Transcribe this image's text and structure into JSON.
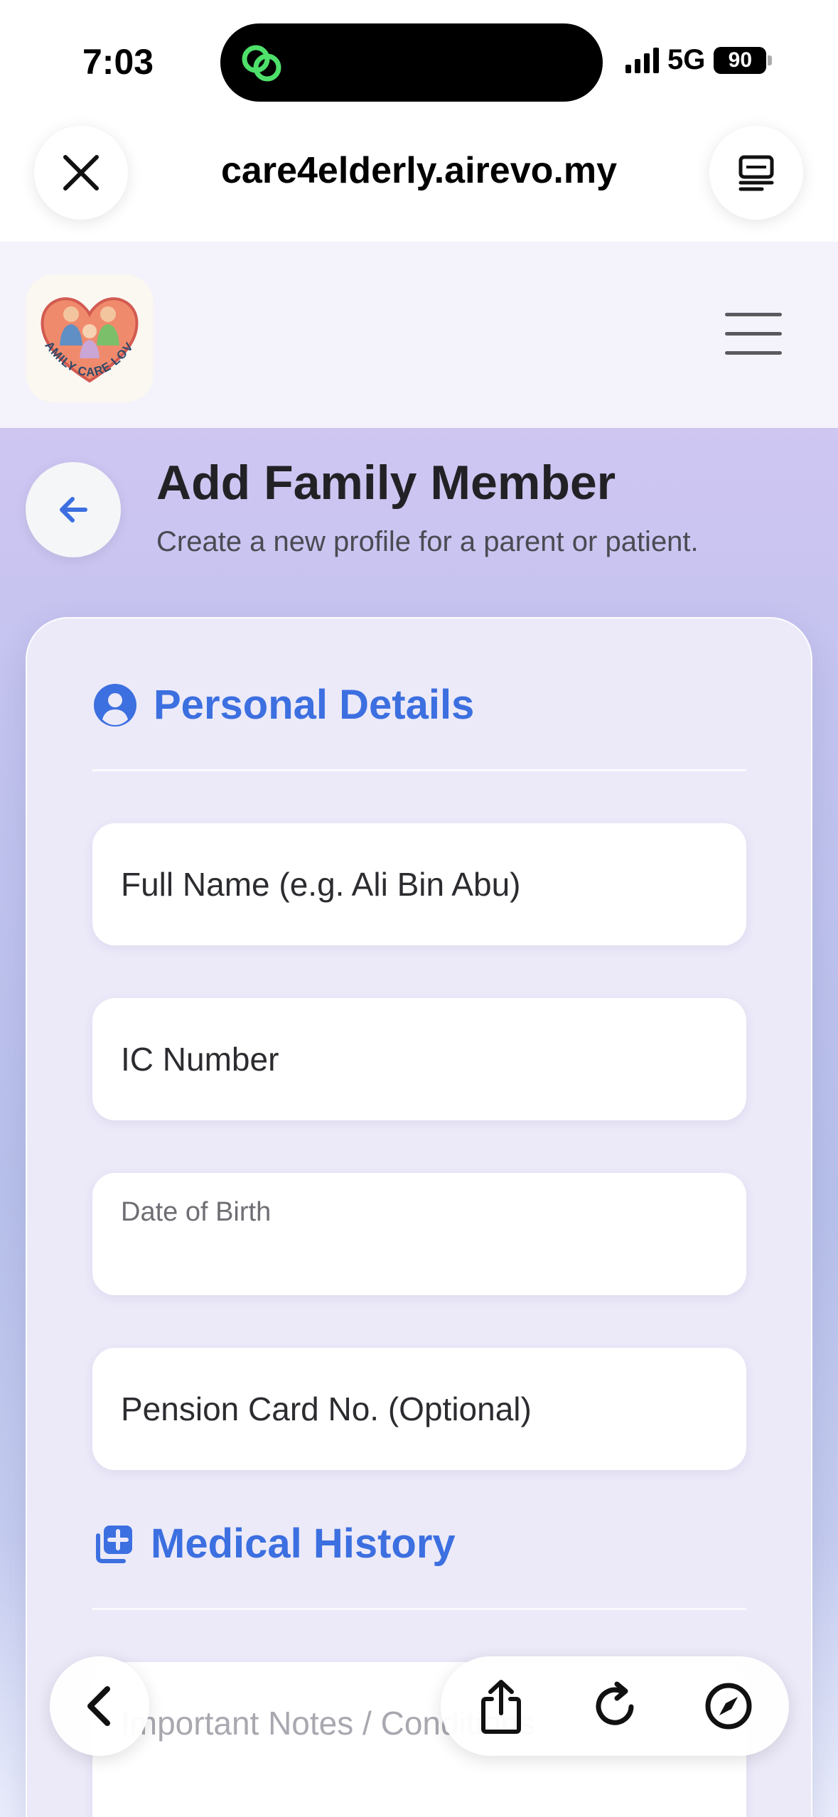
{
  "status": {
    "time": "7:03",
    "network": "5G",
    "battery": "90"
  },
  "browser": {
    "url": "care4elderly.airevo.my"
  },
  "header": {
    "logo_text": "FAMILY CARE LOVE"
  },
  "page": {
    "title": "Add Family Member",
    "subtitle": "Create a new profile for a parent or patient."
  },
  "sections": {
    "personal": {
      "title": "Personal Details"
    },
    "medical": {
      "title": "Medical History"
    }
  },
  "form": {
    "full_name": {
      "placeholder": "Full Name (e.g. Ali Bin Abu)",
      "value": ""
    },
    "ic_number": {
      "placeholder": "IC Number",
      "value": ""
    },
    "dob": {
      "label": "Date of Birth",
      "value": ""
    },
    "pension": {
      "placeholder": "Pension Card No. (Optional)",
      "value": ""
    },
    "notes": {
      "placeholder": "Important Notes / Conditions",
      "value": ""
    }
  },
  "colors": {
    "accent": "#3c6fe0",
    "title": "#222226"
  }
}
